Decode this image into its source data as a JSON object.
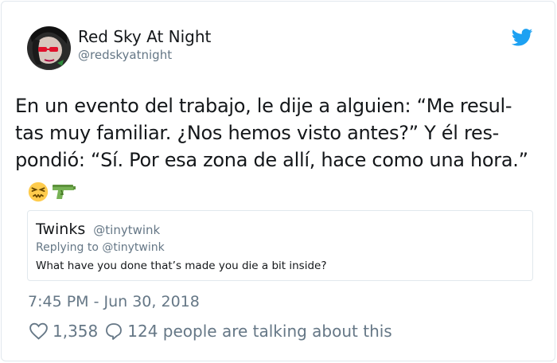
{
  "user": {
    "display_name": "Red Sky At Night",
    "handle": "@redskyatnight"
  },
  "tweet": {
    "lines": [
      "En un evento del trabajo, le dije a alguien: “Me resul-",
      "tas muy familiar. ¿Nos hemos visto antes?” Y él res-",
      "pondió: “Sí. Por esa zona de allí, hace como una hora.”"
    ],
    "emojis": [
      "confounded-face",
      "water-pistol"
    ]
  },
  "quoted_tweet": {
    "display_name": "Twinks",
    "handle": "@tinytwink",
    "replying_to": "Replying to @tinytwink",
    "text": "What have you done that’s made you die a bit inside?"
  },
  "timestamp": "7:45 PM - Jun 30, 2018",
  "engagement": {
    "likes": "1,358",
    "talking": "124 people are talking about this"
  },
  "colors": {
    "text": "#14171a",
    "secondary": "#657786",
    "twitter_blue": "#1da1f2",
    "border": "#e1e8ed"
  },
  "icons": [
    "twitter-bird-icon",
    "heart-icon",
    "comment-bubble-icon"
  ]
}
